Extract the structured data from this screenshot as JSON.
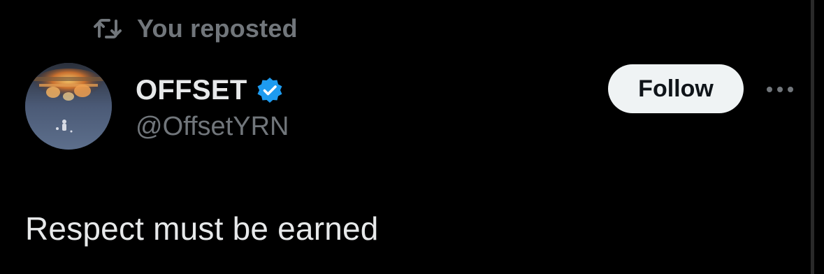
{
  "repost_banner": {
    "icon": "repost-icon",
    "label": "You reposted"
  },
  "author": {
    "display_name": "OFFSET",
    "handle": "@OffsetYRN",
    "verified_icon": "verified-badge-icon",
    "avatar": "avatar-image"
  },
  "actions": {
    "follow_label": "Follow",
    "more_icon": "more-options-icon"
  },
  "post": {
    "text": "Respect must be earned"
  },
  "colors": {
    "background": "#000000",
    "primary_text": "#e7e9ea",
    "secondary_text": "#71767b",
    "verified_blue": "#1d9bf0",
    "follow_button_bg": "#eff3f4",
    "follow_button_text": "#0f1419"
  }
}
